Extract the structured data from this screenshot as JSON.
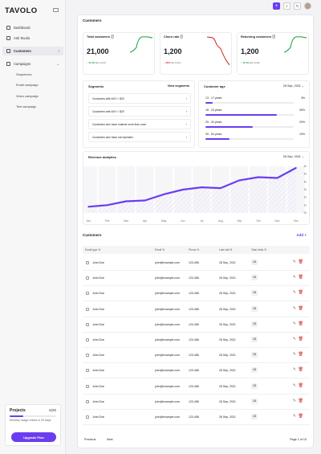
{
  "brand": {
    "logo": "TAVOLO"
  },
  "sidebar": {
    "items": [
      {
        "label": "Dashboard",
        "icon": "home-icon"
      },
      {
        "label": "Ask Tavolo",
        "icon": "sparkle-icon"
      },
      {
        "label": "Customers",
        "icon": "users-icon",
        "active": true
      },
      {
        "label": "Campaigns",
        "icon": "megaphone-icon",
        "expanded": true
      }
    ],
    "subitems": [
      "Sequences",
      "Email campaign",
      "Video campaign",
      "Text campaign"
    ]
  },
  "projects": {
    "title": "Projects",
    "count": "6/20",
    "used_fraction": 0.3,
    "desc": "Monthly usage resets in 29 days",
    "button": "Upgrade Plan"
  },
  "header": {
    "title": "Customers"
  },
  "kpis": [
    {
      "label": "Total customers",
      "value": "21,000",
      "delta": "10.4%",
      "delta_suffix": "last month",
      "trend": "up",
      "color": "#1a9e3b"
    },
    {
      "label": "Churn rate",
      "value": "1,200",
      "delta": "20%",
      "delta_suffix": "last month",
      "trend": "down",
      "color": "#d21d1d"
    },
    {
      "label": "Returning customers",
      "value": "1,200",
      "delta": "10.4%",
      "delta_suffix": "last month",
      "trend": "up",
      "color": "#1a9e3b"
    }
  ],
  "segments": {
    "title": "Segments",
    "link": "View segments",
    "rows": [
      "Customers with AOV > $20",
      "Customers with AOV < $20",
      "Customers who have ordered more than once",
      "Customers who have not repeated"
    ]
  },
  "age": {
    "title": "Customer age",
    "date": "26 Sep, 2021",
    "rows": [
      {
        "label": "13 - 17 years",
        "pct": "3%",
        "value": 3
      },
      {
        "label": "18 - 24 years",
        "pct": "30%",
        "value": 30
      },
      {
        "label": "25 - 34 years",
        "pct": "20%",
        "value": 20
      },
      {
        "label": "30 - 54 years",
        "pct": "10%",
        "value": 10
      }
    ]
  },
  "revenue": {
    "title": "Revenue analytics",
    "date": "26 Sep, 2021"
  },
  "chart_data": {
    "type": "line",
    "title": "Revenue analytics",
    "x": [
      "Jan",
      "Feb",
      "Mar",
      "Apr",
      "May",
      "Jun",
      "Jul",
      "Aug",
      "Sep",
      "Oct",
      "Nov",
      "Dec"
    ],
    "values": [
      0.8,
      1.0,
      1.5,
      1.6,
      2.4,
      3.0,
      3.3,
      3.2,
      4.2,
      4.6,
      4.5,
      5.8
    ],
    "ylim": [
      0,
      6
    ],
    "y_ticks": [
      "0k",
      "1k",
      "2k",
      "3k",
      "4k",
      "5k",
      "6k"
    ],
    "color": "#6b3df0"
  },
  "customers_table": {
    "title": "Customers",
    "add": "Add",
    "headers": [
      "Email type",
      "Email",
      "Phone",
      "Last visit",
      "Total visits"
    ],
    "rows": [
      {
        "name": "John Doe",
        "email": "john@example.com",
        "phone": "123-456",
        "last": "26 Sep, 2021",
        "visits": "15"
      },
      {
        "name": "John Doe",
        "email": "john@example.com",
        "phone": "123-456",
        "last": "26 Sep, 2021",
        "visits": "15"
      },
      {
        "name": "John Doe",
        "email": "john@example.com",
        "phone": "123-456",
        "last": "26 Sep, 2021",
        "visits": "15"
      },
      {
        "name": "John Doe",
        "email": "john@example.com",
        "phone": "123-456",
        "last": "26 Sep, 2021",
        "visits": "15"
      },
      {
        "name": "John Doe",
        "email": "john@example.com",
        "phone": "123-456",
        "last": "26 Sep, 2021",
        "visits": "15"
      },
      {
        "name": "John Doe",
        "email": "john@example.com",
        "phone": "123-456",
        "last": "26 Sep, 2021",
        "visits": "15"
      },
      {
        "name": "John Doe",
        "email": "john@example.com",
        "phone": "123-456",
        "last": "26 Sep, 2021",
        "visits": "15"
      },
      {
        "name": "John Doe",
        "email": "john@example.com",
        "phone": "123-456",
        "last": "26 Sep, 2021",
        "visits": "15"
      },
      {
        "name": "John Doe",
        "email": "john@example.com",
        "phone": "123-456",
        "last": "26 Sep, 2021",
        "visits": "15"
      },
      {
        "name": "John Doe",
        "email": "john@example.com",
        "phone": "123-456",
        "last": "26 Sep, 2021",
        "visits": "15"
      },
      {
        "name": "John Doe",
        "email": "john@example.com",
        "phone": "123-456",
        "last": "26 Sep, 2021",
        "visits": "15"
      }
    ]
  },
  "pagination": {
    "prev": "Previous",
    "next": "Next",
    "page": "Page 1 of 10"
  }
}
